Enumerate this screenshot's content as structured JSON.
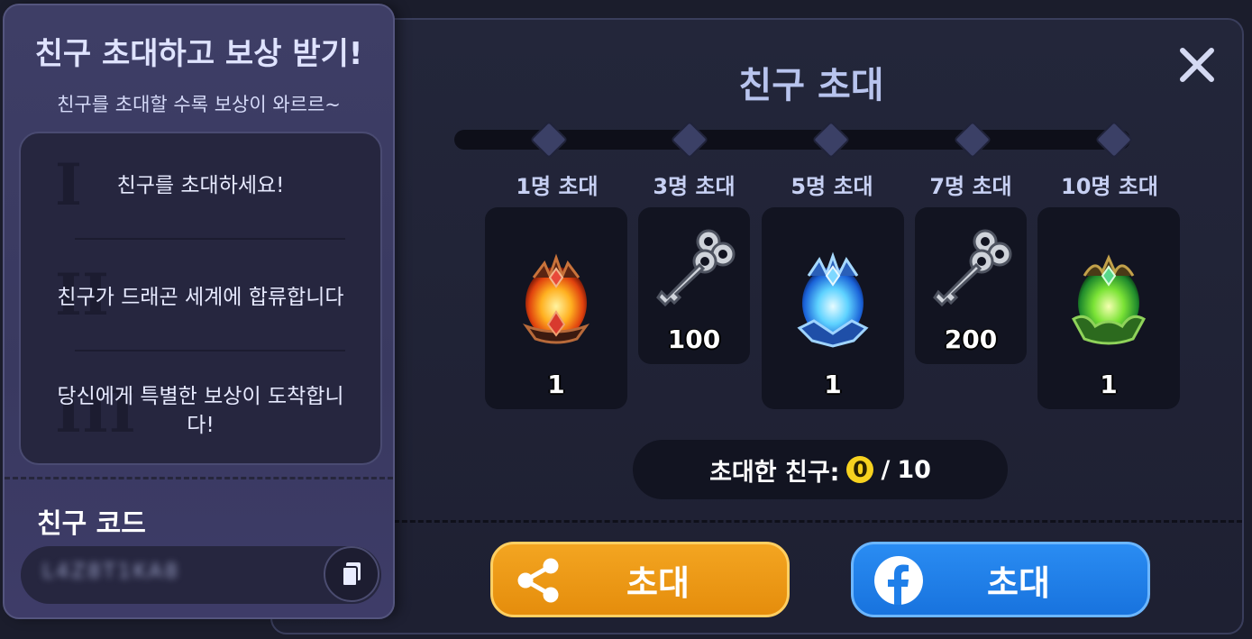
{
  "dialog": {
    "title": "친구 초대"
  },
  "milestones": [
    {
      "label": "1명 초대",
      "reward": "fire-egg-icon",
      "count": "1"
    },
    {
      "label": "3명 초대",
      "reward": "key-icon",
      "count": "100"
    },
    {
      "label": "5명 초대",
      "reward": "ice-egg-icon",
      "count": "1"
    },
    {
      "label": "7명 초대",
      "reward": "key-icon",
      "count": "200"
    },
    {
      "label": "10명 초대",
      "reward": "nature-egg-icon",
      "count": "1"
    }
  ],
  "progress": {
    "label": "초대한 친구:",
    "current": "0",
    "separator": "/",
    "total": "10"
  },
  "buttons": {
    "share_label": "초대",
    "facebook_label": "초대"
  },
  "side": {
    "title": "친구 초대하고 보상 받기!",
    "subtitle": "친구를 초대할 수록 보상이 와르르~",
    "steps": [
      {
        "numeral": "I",
        "text": "친구를 초대하세요!"
      },
      {
        "numeral": "II",
        "text": "친구가 드래곤 세계에 합류합니다"
      },
      {
        "numeral": "III",
        "text": "당신에게 특별한 보상이 도착합니다!"
      }
    ],
    "code_label": "친구 코드",
    "code_value": "L4Z8T1KA8"
  },
  "colors": {
    "share_button": "#f3a521",
    "facebook_button": "#1f7fe9",
    "progress_current_badge": "#f7d21f"
  }
}
